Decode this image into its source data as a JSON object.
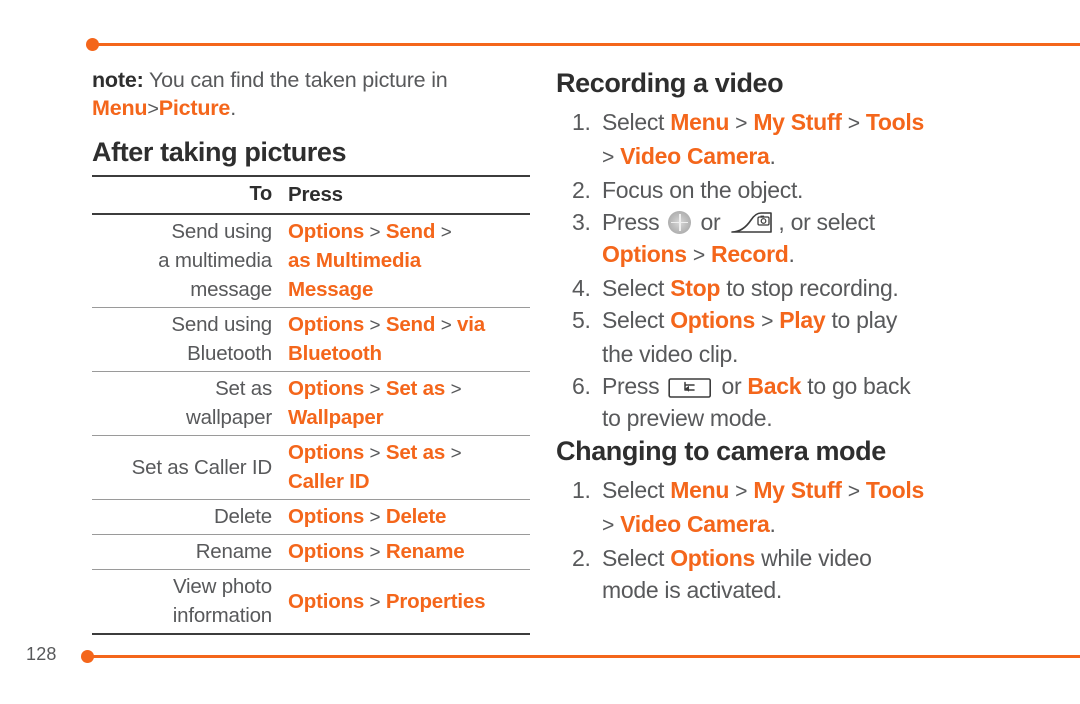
{
  "page": {
    "number": "128",
    "accent_color": "#F4661B",
    "text_color": "#58595B",
    "heading_color": "#2E2E2E"
  },
  "left_column": {
    "note": {
      "label": "note:",
      "text": "You can find the taken picture in",
      "path_1": "Menu",
      "separator": ">",
      "path_2": "Picture",
      "period": "."
    },
    "section_title": "After taking pictures",
    "table": {
      "headers": {
        "to": "To",
        "press": "Press"
      },
      "rows": [
        {
          "to": [
            "Send using",
            "a multimedia",
            "message"
          ],
          "press_lines": [
            [
              {
                "t": "Options",
                "k": "o"
              },
              {
                "t": ">",
                "k": "s"
              },
              {
                "t": "Send",
                "k": "o"
              },
              {
                "t": ">",
                "k": "s"
              }
            ],
            [
              {
                "t": "as Multimedia",
                "k": "o"
              }
            ],
            [
              {
                "t": "Message",
                "k": "o"
              }
            ]
          ]
        },
        {
          "to": [
            "Send using",
            "Bluetooth"
          ],
          "press_lines": [
            [
              {
                "t": "Options",
                "k": "o"
              },
              {
                "t": ">",
                "k": "s"
              },
              {
                "t": "Send",
                "k": "o"
              },
              {
                "t": ">",
                "k": "s"
              },
              {
                "t": "via",
                "k": "o"
              }
            ],
            [
              {
                "t": "Bluetooth",
                "k": "o"
              }
            ]
          ]
        },
        {
          "to": [
            "Set as",
            "wallpaper"
          ],
          "press_lines": [
            [
              {
                "t": "Options",
                "k": "o"
              },
              {
                "t": ">",
                "k": "s"
              },
              {
                "t": "Set as",
                "k": "o"
              },
              {
                "t": ">",
                "k": "s"
              }
            ],
            [
              {
                "t": "Wallpaper",
                "k": "o"
              }
            ]
          ]
        },
        {
          "to": [
            "Set as Caller ID"
          ],
          "press_lines": [
            [
              {
                "t": "Options",
                "k": "o"
              },
              {
                "t": ">",
                "k": "s"
              },
              {
                "t": "Set as",
                "k": "o"
              },
              {
                "t": ">",
                "k": "s"
              }
            ],
            [
              {
                "t": "Caller ID",
                "k": "o"
              }
            ]
          ]
        },
        {
          "to": [
            "Delete"
          ],
          "press_lines": [
            [
              {
                "t": "Options",
                "k": "o"
              },
              {
                "t": ">",
                "k": "s"
              },
              {
                "t": "Delete",
                "k": "o"
              }
            ]
          ]
        },
        {
          "to": [
            "Rename"
          ],
          "press_lines": [
            [
              {
                "t": "Options",
                "k": "o"
              },
              {
                "t": ">",
                "k": "s"
              },
              {
                "t": "Rename",
                "k": "o"
              }
            ]
          ]
        },
        {
          "to": [
            "View photo",
            "information"
          ],
          "press_lines": [
            [
              {
                "t": "Options",
                "k": "o"
              },
              {
                "t": ">",
                "k": "s"
              },
              {
                "t": "Properties",
                "k": "o"
              }
            ]
          ]
        }
      ]
    }
  },
  "right_column": {
    "section_1": {
      "title": "Recording a video",
      "steps": [
        {
          "num": "1.",
          "line1": {
            "pre": "Select ",
            "p1": "Menu",
            "s1": ">",
            "p2": "My Stuff",
            "s2": ">",
            "p3": "Tools"
          },
          "line2": {
            "sep": ">",
            "p1": "Video Camera",
            "post": "."
          }
        },
        {
          "num": "2.",
          "text": "Focus on the object."
        },
        {
          "num": "3.",
          "pre": "Press ",
          "icon_1": "navigation-key-icon",
          "mid": " or ",
          "icon_2": "camera-soft-key-icon",
          "post": ", or select",
          "line2": {
            "p1": "Options",
            "sep": ">",
            "p2": "Record",
            "post": "."
          }
        },
        {
          "num": "4.",
          "pre": "Select ",
          "p1": "Stop",
          "post": " to stop recording."
        },
        {
          "num": "5.",
          "pre": "Select ",
          "p1": "Options",
          "sep": ">",
          "p2": "Play",
          "post": " to play",
          "line2": "the video clip."
        },
        {
          "num": "6.",
          "pre": "Press ",
          "icon_1": "back-key-icon",
          "mid": " or ",
          "p1": "Back",
          "post": " to go back",
          "line2": "to preview mode."
        }
      ]
    },
    "section_2": {
      "title": "Changing to camera mode",
      "steps": [
        {
          "num": "1.",
          "line1": {
            "pre": "Select ",
            "p1": "Menu",
            "s1": ">",
            "p2": "My Stuff",
            "s2": ">",
            "p3": "Tools"
          },
          "line2": {
            "sep": ">",
            "p1": "Video Camera",
            "post": "."
          }
        },
        {
          "num": "2.",
          "pre": "Select ",
          "p1": "Options",
          "post": " while video",
          "line2": "mode is activated."
        }
      ]
    }
  }
}
